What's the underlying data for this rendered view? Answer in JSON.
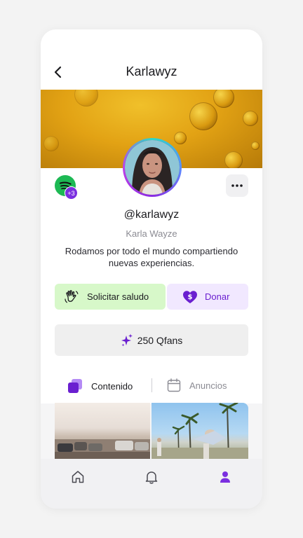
{
  "header": {
    "title": "Karlawyz"
  },
  "profile": {
    "handle": "@karlawyz",
    "name": "Karla Wayze",
    "bio": "Rodamos por todo el mundo compartiendo nuevas experiencias.",
    "linked_accounts_badge": "+3"
  },
  "actions": {
    "greet_label": "Solicitar saludo",
    "donate_label": "Donar",
    "qfans_label": "250 Qfans"
  },
  "tabs": [
    {
      "label": "Contenido",
      "active": true,
      "icon": "stacked-squares-icon"
    },
    {
      "label": "Anuncios",
      "active": false,
      "icon": "calendar-icon"
    }
  ],
  "nav": [
    {
      "icon": "home-icon",
      "active": false
    },
    {
      "icon": "bell-icon",
      "active": false
    },
    {
      "icon": "profile-icon",
      "active": true
    }
  ],
  "colors": {
    "accent": "#7b2fe0",
    "greet_bg": "#d7f8c9",
    "donate_bg": "#f1e8ff",
    "spotify": "#1db954"
  }
}
